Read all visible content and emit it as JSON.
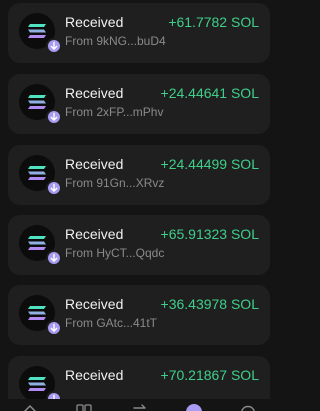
{
  "transactions": [
    {
      "title": "Received",
      "from": "From 9kNG...buD4",
      "amount": "+61.7782 SOL",
      "token_icon": "solana-icon",
      "badge_icon": "arrow-down-icon"
    },
    {
      "title": "Received",
      "from": "From 2xFP...mPhv",
      "amount": "+24.44641 SOL",
      "token_icon": "solana-icon",
      "badge_icon": "arrow-down-icon"
    },
    {
      "title": "Received",
      "from": "From 91Gn...XRvz",
      "amount": "+24.44499 SOL",
      "token_icon": "solana-icon",
      "badge_icon": "arrow-down-icon"
    },
    {
      "title": "Received",
      "from": "From HyCT...Qqdc",
      "amount": "+65.91323 SOL",
      "token_icon": "solana-icon",
      "badge_icon": "arrow-down-icon"
    },
    {
      "title": "Received",
      "from": "From GAtc...41tT",
      "amount": "+36.43978 SOL",
      "token_icon": "solana-icon",
      "badge_icon": "arrow-down-icon"
    },
    {
      "title": "Received",
      "from": "",
      "amount": "+70.21867 SOL",
      "token_icon": "solana-icon",
      "badge_icon": "arrow-down-icon"
    }
  ],
  "tab_bar": {
    "tabs": [
      {
        "icon": "home-icon"
      },
      {
        "icon": "grid-icon"
      },
      {
        "icon": "swap-icon"
      },
      {
        "icon": "activity-icon",
        "active": true
      },
      {
        "icon": "explore-icon"
      }
    ]
  },
  "colors": {
    "background": "#141414",
    "card": "#1f1f1f",
    "amount_positive": "#3fcf8a",
    "badge": "#a79af2",
    "primary_text": "#f2f2f2",
    "secondary_text": "#8a8a8a"
  }
}
